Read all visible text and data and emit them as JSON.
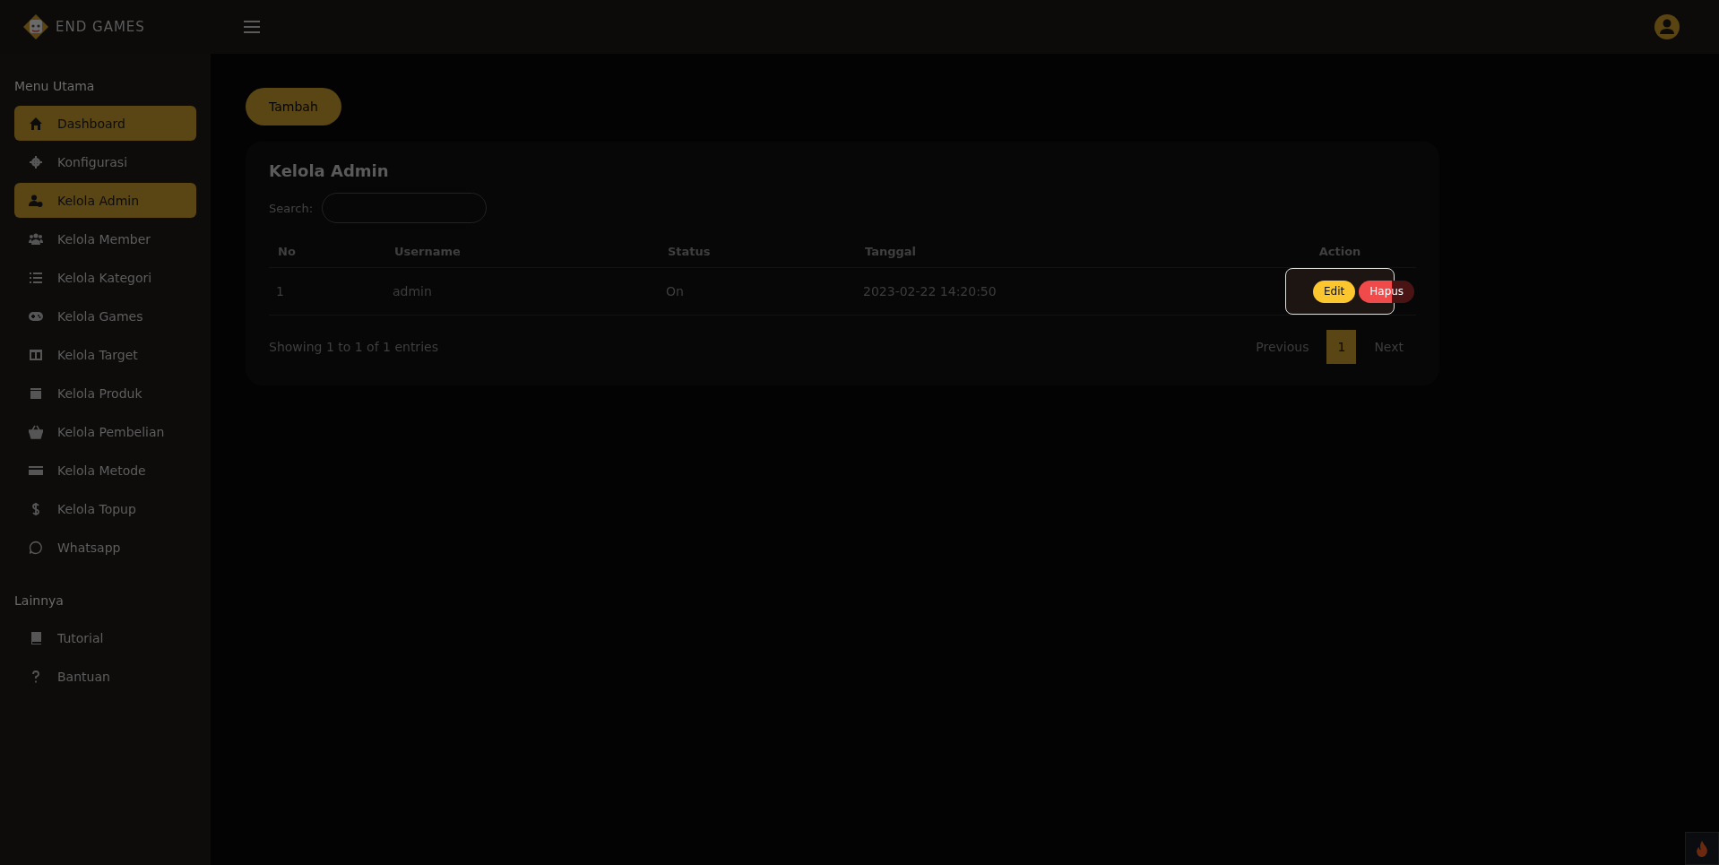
{
  "header": {
    "brand": "END GAMES"
  },
  "sidebar": {
    "sections": [
      {
        "title": "Menu Utama",
        "items": [
          {
            "label": "Dashboard",
            "selected": true
          },
          {
            "label": "Konfigurasi",
            "selected": false
          },
          {
            "label": "Kelola Admin",
            "selected": true
          },
          {
            "label": "Kelola Member",
            "selected": false
          },
          {
            "label": "Kelola Kategori",
            "selected": false
          },
          {
            "label": "Kelola Games",
            "selected": false
          },
          {
            "label": "Kelola Target",
            "selected": false
          },
          {
            "label": "Kelola Produk",
            "selected": false
          },
          {
            "label": "Kelola Pembelian",
            "selected": false
          },
          {
            "label": "Kelola Metode",
            "selected": false
          },
          {
            "label": "Kelola Topup",
            "selected": false
          },
          {
            "label": "Whatsapp",
            "selected": false
          }
        ]
      },
      {
        "title": "Lainnya",
        "items": [
          {
            "label": "Tutorial",
            "selected": false
          },
          {
            "label": "Bantuan",
            "selected": false
          }
        ]
      }
    ]
  },
  "main": {
    "add_button": "Tambah",
    "card": {
      "title": "Kelola Admin",
      "search_label": "Search:",
      "table": {
        "columns": [
          "No",
          "Username",
          "Status",
          "Tanggal",
          "Action"
        ],
        "rows": [
          {
            "cells": [
              "1",
              "admin",
              "On",
              "2023-02-22 14:20:50"
            ],
            "actions": [
              {
                "label": "Edit",
                "kind": "edit"
              },
              {
                "label": "Hapus",
                "kind": "delete"
              }
            ]
          }
        ]
      },
      "info": "Showing 1 to 1 of 1 entries",
      "pagination": [
        {
          "label": "Previous",
          "selected": false
        },
        {
          "label": "1",
          "selected": true
        },
        {
          "label": "Next",
          "selected": false
        }
      ]
    }
  }
}
